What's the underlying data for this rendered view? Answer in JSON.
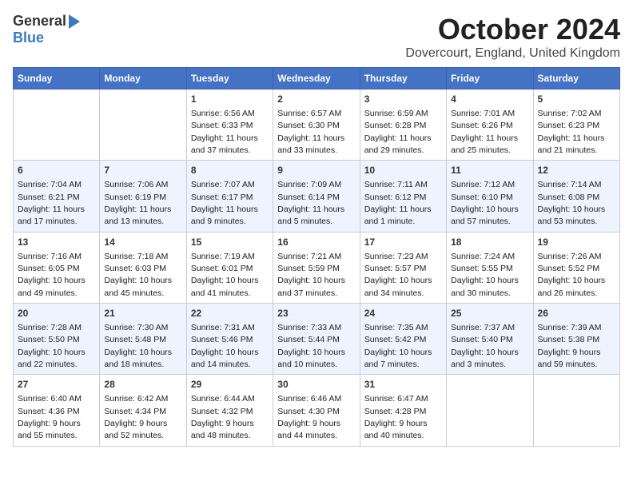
{
  "header": {
    "logo_general": "General",
    "logo_blue": "Blue",
    "month_title": "October 2024",
    "location": "Dovercourt, England, United Kingdom"
  },
  "weekdays": [
    "Sunday",
    "Monday",
    "Tuesday",
    "Wednesday",
    "Thursday",
    "Friday",
    "Saturday"
  ],
  "weeks": [
    [
      {
        "day": "",
        "details": ""
      },
      {
        "day": "",
        "details": ""
      },
      {
        "day": "1",
        "details": "Sunrise: 6:56 AM\nSunset: 6:33 PM\nDaylight: 11 hours and 37 minutes."
      },
      {
        "day": "2",
        "details": "Sunrise: 6:57 AM\nSunset: 6:30 PM\nDaylight: 11 hours and 33 minutes."
      },
      {
        "day": "3",
        "details": "Sunrise: 6:59 AM\nSunset: 6:28 PM\nDaylight: 11 hours and 29 minutes."
      },
      {
        "day": "4",
        "details": "Sunrise: 7:01 AM\nSunset: 6:26 PM\nDaylight: 11 hours and 25 minutes."
      },
      {
        "day": "5",
        "details": "Sunrise: 7:02 AM\nSunset: 6:23 PM\nDaylight: 11 hours and 21 minutes."
      }
    ],
    [
      {
        "day": "6",
        "details": "Sunrise: 7:04 AM\nSunset: 6:21 PM\nDaylight: 11 hours and 17 minutes."
      },
      {
        "day": "7",
        "details": "Sunrise: 7:06 AM\nSunset: 6:19 PM\nDaylight: 11 hours and 13 minutes."
      },
      {
        "day": "8",
        "details": "Sunrise: 7:07 AM\nSunset: 6:17 PM\nDaylight: 11 hours and 9 minutes."
      },
      {
        "day": "9",
        "details": "Sunrise: 7:09 AM\nSunset: 6:14 PM\nDaylight: 11 hours and 5 minutes."
      },
      {
        "day": "10",
        "details": "Sunrise: 7:11 AM\nSunset: 6:12 PM\nDaylight: 11 hours and 1 minute."
      },
      {
        "day": "11",
        "details": "Sunrise: 7:12 AM\nSunset: 6:10 PM\nDaylight: 10 hours and 57 minutes."
      },
      {
        "day": "12",
        "details": "Sunrise: 7:14 AM\nSunset: 6:08 PM\nDaylight: 10 hours and 53 minutes."
      }
    ],
    [
      {
        "day": "13",
        "details": "Sunrise: 7:16 AM\nSunset: 6:05 PM\nDaylight: 10 hours and 49 minutes."
      },
      {
        "day": "14",
        "details": "Sunrise: 7:18 AM\nSunset: 6:03 PM\nDaylight: 10 hours and 45 minutes."
      },
      {
        "day": "15",
        "details": "Sunrise: 7:19 AM\nSunset: 6:01 PM\nDaylight: 10 hours and 41 minutes."
      },
      {
        "day": "16",
        "details": "Sunrise: 7:21 AM\nSunset: 5:59 PM\nDaylight: 10 hours and 37 minutes."
      },
      {
        "day": "17",
        "details": "Sunrise: 7:23 AM\nSunset: 5:57 PM\nDaylight: 10 hours and 34 minutes."
      },
      {
        "day": "18",
        "details": "Sunrise: 7:24 AM\nSunset: 5:55 PM\nDaylight: 10 hours and 30 minutes."
      },
      {
        "day": "19",
        "details": "Sunrise: 7:26 AM\nSunset: 5:52 PM\nDaylight: 10 hours and 26 minutes."
      }
    ],
    [
      {
        "day": "20",
        "details": "Sunrise: 7:28 AM\nSunset: 5:50 PM\nDaylight: 10 hours and 22 minutes."
      },
      {
        "day": "21",
        "details": "Sunrise: 7:30 AM\nSunset: 5:48 PM\nDaylight: 10 hours and 18 minutes."
      },
      {
        "day": "22",
        "details": "Sunrise: 7:31 AM\nSunset: 5:46 PM\nDaylight: 10 hours and 14 minutes."
      },
      {
        "day": "23",
        "details": "Sunrise: 7:33 AM\nSunset: 5:44 PM\nDaylight: 10 hours and 10 minutes."
      },
      {
        "day": "24",
        "details": "Sunrise: 7:35 AM\nSunset: 5:42 PM\nDaylight: 10 hours and 7 minutes."
      },
      {
        "day": "25",
        "details": "Sunrise: 7:37 AM\nSunset: 5:40 PM\nDaylight: 10 hours and 3 minutes."
      },
      {
        "day": "26",
        "details": "Sunrise: 7:39 AM\nSunset: 5:38 PM\nDaylight: 9 hours and 59 minutes."
      }
    ],
    [
      {
        "day": "27",
        "details": "Sunrise: 6:40 AM\nSunset: 4:36 PM\nDaylight: 9 hours and 55 minutes."
      },
      {
        "day": "28",
        "details": "Sunrise: 6:42 AM\nSunset: 4:34 PM\nDaylight: 9 hours and 52 minutes."
      },
      {
        "day": "29",
        "details": "Sunrise: 6:44 AM\nSunset: 4:32 PM\nDaylight: 9 hours and 48 minutes."
      },
      {
        "day": "30",
        "details": "Sunrise: 6:46 AM\nSunset: 4:30 PM\nDaylight: 9 hours and 44 minutes."
      },
      {
        "day": "31",
        "details": "Sunrise: 6:47 AM\nSunset: 4:28 PM\nDaylight: 9 hours and 40 minutes."
      },
      {
        "day": "",
        "details": ""
      },
      {
        "day": "",
        "details": ""
      }
    ]
  ]
}
